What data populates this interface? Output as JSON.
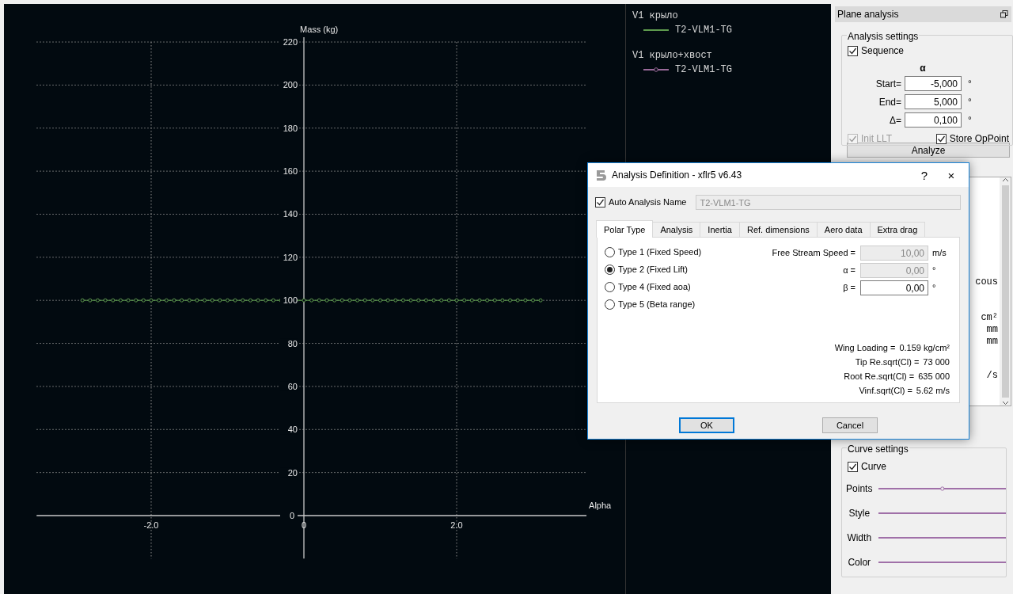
{
  "chart_panel": {
    "chart_data": {
      "type": "line",
      "xlabel": "Alpha",
      "ylabel": "Mass (kg)",
      "x": [
        -2.9,
        -2.8,
        -2.7,
        -2.6,
        -2.5,
        -2.4,
        -2.3,
        -2.2,
        -2.1,
        -2.0,
        -1.9,
        -1.8,
        -1.7,
        -1.6,
        -1.5,
        -1.4,
        -1.3,
        -1.2,
        -1.1,
        -1.0,
        -0.9,
        -0.8,
        -0.7,
        -0.6,
        -0.5,
        -0.4,
        -0.3,
        -0.2,
        -0.1,
        0.0,
        0.1,
        0.2,
        0.3,
        0.4,
        0.5,
        0.6,
        0.7,
        0.8,
        0.9,
        1.0,
        1.1,
        1.2,
        1.3,
        1.4,
        1.5,
        1.6,
        1.7,
        1.8,
        1.9,
        2.0,
        2.1,
        2.2,
        2.3,
        2.4,
        2.5,
        2.6,
        2.7,
        2.8,
        2.9,
        3.0,
        3.1
      ],
      "series": [
        {
          "color": "#5e9a4e",
          "marker": "circle",
          "values": [
            100,
            100,
            100,
            100,
            100,
            100,
            100,
            100,
            100,
            100,
            100,
            100,
            100,
            100,
            100,
            100,
            100,
            100,
            100,
            100,
            100,
            100,
            100,
            100,
            100,
            100,
            100,
            100,
            100,
            100,
            100,
            100,
            100,
            100,
            100,
            100,
            100,
            100,
            100,
            100,
            100,
            100,
            100,
            100,
            100,
            100,
            100,
            100,
            100,
            100,
            100,
            100,
            100,
            100,
            100,
            100,
            100,
            100,
            100,
            100,
            100
          ]
        }
      ],
      "grid": true,
      "xlim": [
        -3.5,
        3.7
      ],
      "ylim": [
        -20,
        220
      ],
      "xticks": [
        {
          "value": -2,
          "label": "-2.0"
        },
        {
          "value": 0,
          "label": "0"
        },
        {
          "value": 2,
          "label": "2.0"
        }
      ],
      "yticks": [
        0,
        20,
        40,
        60,
        80,
        100,
        120,
        140,
        160,
        180,
        200,
        220
      ]
    }
  },
  "legend": [
    {
      "plane": "V1 крыло",
      "polars": [
        {
          "name": "T2-VLM1-TG",
          "color": "#5e9a4e",
          "markers": false
        }
      ]
    },
    {
      "plane": "V1 крыло+хвост",
      "polars": [
        {
          "name": "T2-VLM1-TG",
          "color": "#9a6a9a",
          "markers": true
        }
      ]
    }
  ],
  "plane_analysis": {
    "title": "Plane analysis",
    "analysis_settings": {
      "title": "Analysis settings",
      "sequence": {
        "label": "Sequence",
        "checked": true
      },
      "variable": "α",
      "fields": [
        {
          "label": "Start=",
          "value": "-5,000",
          "unit": "°"
        },
        {
          "label": "End=",
          "value": "5,000",
          "unit": "°"
        },
        {
          "label": "Δ=",
          "value": "0,100",
          "unit": "°"
        }
      ],
      "init_llt": {
        "label": "Init LLT",
        "checked": true,
        "disabled": true
      },
      "store_oppoint": {
        "label": "Store OpPoint",
        "checked": true,
        "disabled": false
      },
      "analyze_button": "Analyze"
    },
    "output_fragments": [
      "cous",
      "cm²",
      "mm",
      "mm",
      "/s"
    ],
    "curve_settings": {
      "title": "Curve settings",
      "curve": {
        "label": "Curve",
        "checked": true
      },
      "color": "#a070a8",
      "rows": [
        {
          "label": "Points",
          "kind": "points"
        },
        {
          "label": "Style",
          "kind": "line"
        },
        {
          "label": "Width",
          "kind": "line"
        },
        {
          "label": "Color",
          "kind": "line"
        }
      ]
    }
  },
  "dialog": {
    "title": "Analysis Definition - xflr5 v6.43",
    "help": "?",
    "close": "×",
    "auto_name": {
      "label": "Auto Analysis Name",
      "checked": true,
      "value": "T2-VLM1-TG"
    },
    "tabs": [
      {
        "label": "Polar Type",
        "selected": true
      },
      {
        "label": "Analysis",
        "selected": false
      },
      {
        "label": "Inertia",
        "selected": false
      },
      {
        "label": "Ref. dimensions",
        "selected": false
      },
      {
        "label": "Aero data",
        "selected": false
      },
      {
        "label": "Extra drag",
        "selected": false
      }
    ],
    "polar_types": [
      {
        "label": "Type 1 (Fixed Speed)",
        "selected": false
      },
      {
        "label": "Type 2 (Fixed Lift)",
        "selected": true
      },
      {
        "label": "Type 4 (Fixed aoa)",
        "selected": false
      },
      {
        "label": "Type 5 (Beta range)",
        "selected": false
      }
    ],
    "fields": [
      {
        "label": "Free Stream Speed =",
        "value": "10,00",
        "unit": "m/s",
        "disabled": true
      },
      {
        "label": "α =",
        "value": "0,00",
        "unit": "°",
        "disabled": true
      },
      {
        "label": "β =",
        "value": "0,00",
        "unit": "°",
        "disabled": false
      }
    ],
    "info": [
      {
        "label": "Wing Loading =",
        "value": "0.159 kg/cm²"
      },
      {
        "label": "Tip Re.sqrt(Cl) =",
        "value": "73 000"
      },
      {
        "label": "Root Re.sqrt(Cl) =",
        "value": "635 000"
      },
      {
        "label": "Vinf.sqrt(Cl) =",
        "value": "5.62 m/s"
      }
    ],
    "buttons": [
      {
        "label": "OK",
        "default": true
      },
      {
        "label": "Cancel",
        "default": false
      }
    ]
  }
}
